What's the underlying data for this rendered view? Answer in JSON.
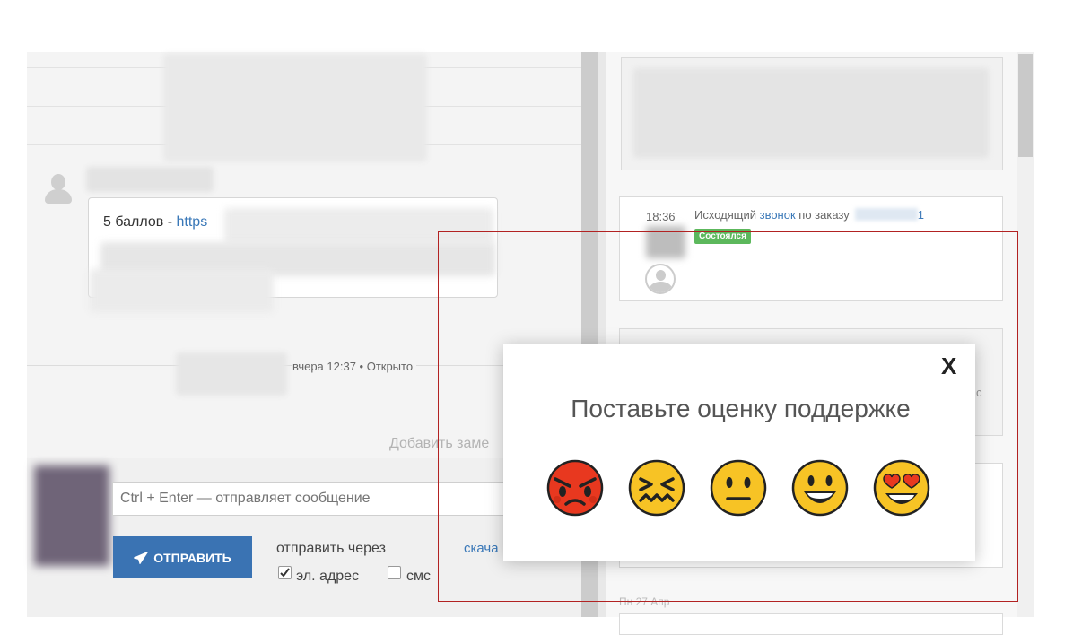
{
  "chat": {
    "message_prefix": "5 баллов - ",
    "message_link": "https",
    "event_text": "вчера 12:37 • Открыто",
    "add_note": "Добавить заме"
  },
  "composer": {
    "input_placeholder": "Ctrl + Enter — отправляет сообщение",
    "send_label": "ОТПРАВИТЬ",
    "send_via_label": "отправить через",
    "download_label": "скача",
    "email_label": "эл. адрес",
    "email_checked": true,
    "sms_label": "смс",
    "sms_checked": false
  },
  "activity": {
    "call_time": "18:36",
    "call_prefix": "Исходящий ",
    "call_link": "звонок",
    "call_suffix": " по заказу",
    "call_order_tail": "1",
    "call_status": "Состоялся",
    "partial_text": "с",
    "date_label": "Пн 27 Апр"
  },
  "rating_popup": {
    "close_label": "X",
    "title": "Поставьте оценку поддержке",
    "options": [
      "angry-face",
      "confounded-face",
      "neutral-face",
      "grinning-face",
      "heart-eyes-face"
    ]
  },
  "colors": {
    "primary_button": "#3a73b3",
    "link": "#3a78b8",
    "status_success": "#5cb85c",
    "highlight_border": "#b22222"
  }
}
